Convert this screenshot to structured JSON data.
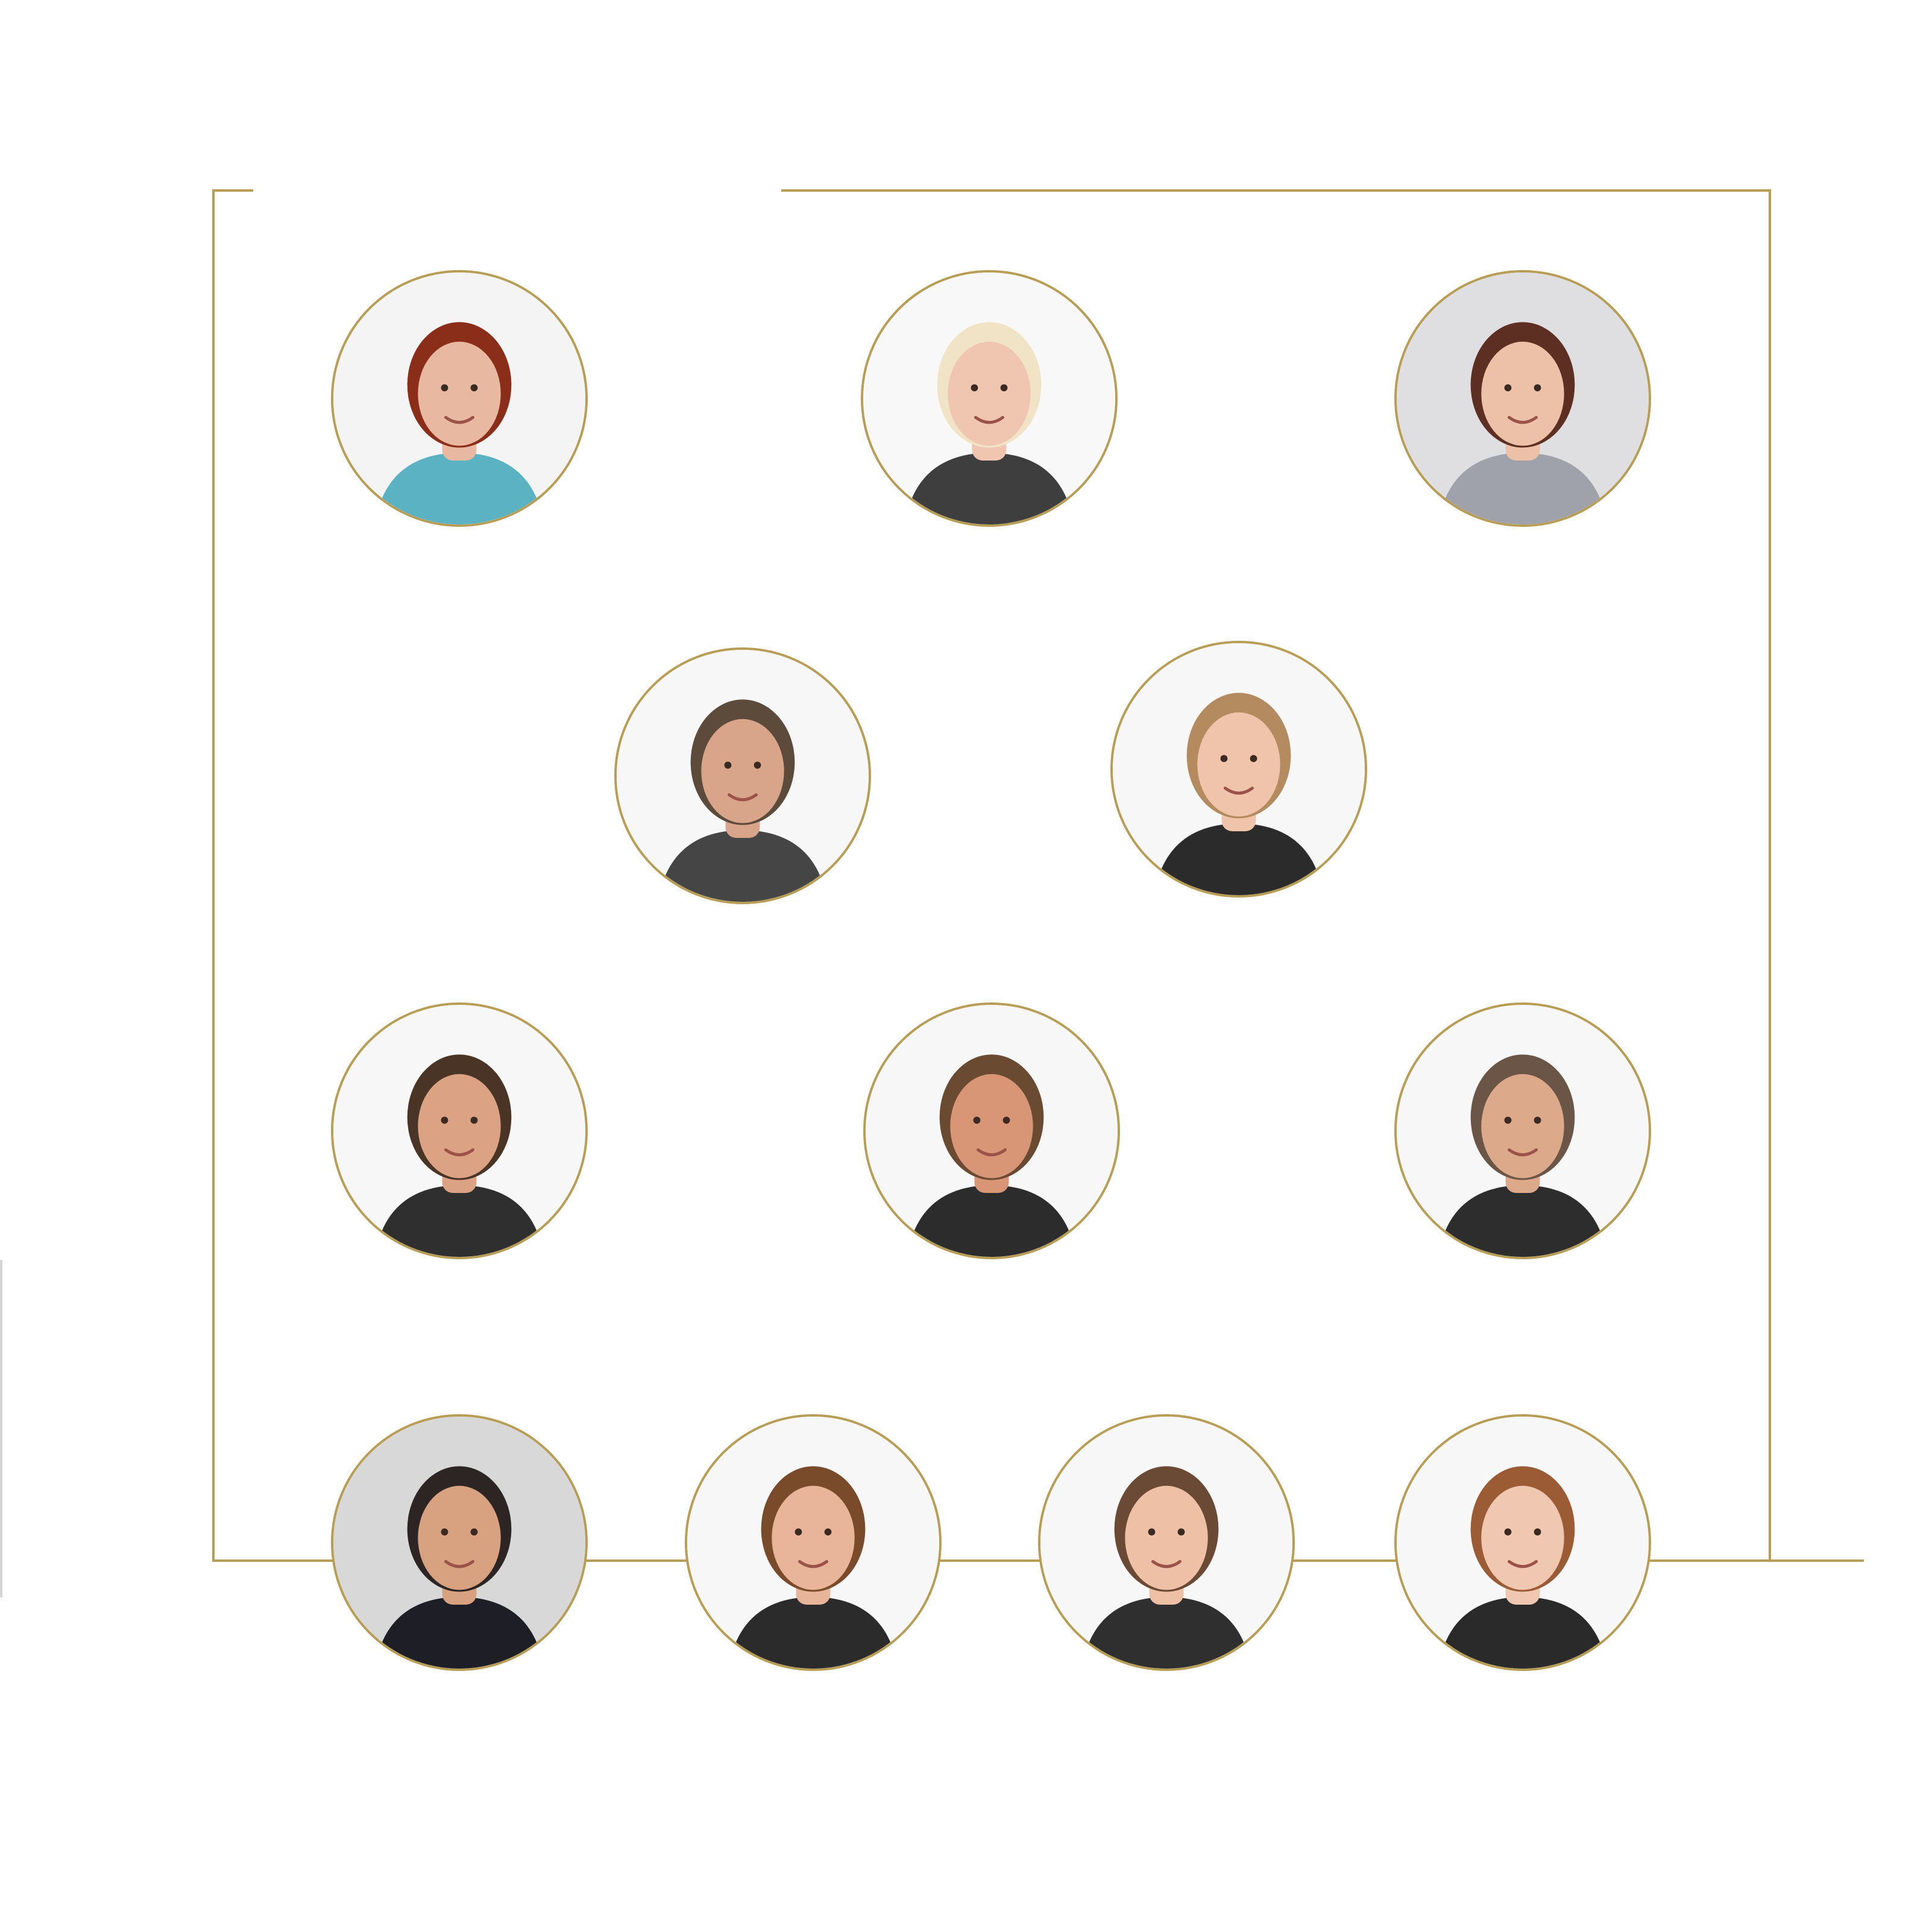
{
  "colors": {
    "accent_gold": "#b89d55",
    "background": "#ffffff"
  },
  "portraits": [
    {
      "name": "woman-red-hair",
      "bg": "#f4f4f4",
      "skin": "#e8b9a0",
      "hair": "#8a2e1a",
      "shirt": "#5bb2c2"
    },
    {
      "name": "woman-blonde-hair",
      "bg": "#f8f8f8",
      "skin": "#f0c6b0",
      "hair": "#f1e4c6",
      "shirt": "#3e3e3e"
    },
    {
      "name": "woman-brown-hair",
      "bg": "#dfdfe2",
      "skin": "#ecc1a8",
      "hair": "#5d2f22",
      "shirt": "#9fa2aa"
    },
    {
      "name": "man-headset-glasses",
      "bg": "#f7f7f7",
      "skin": "#d8a58b",
      "hair": "#5c4a3a",
      "shirt": "#454545"
    },
    {
      "name": "young-man-blond",
      "bg": "#f7f7f7",
      "skin": "#f0c4aa",
      "hair": "#b48a5f",
      "shirt": "#2b2b2b"
    },
    {
      "name": "man-curly-beard",
      "bg": "#f7f7f7",
      "skin": "#dba384",
      "hair": "#4a3426",
      "shirt": "#2f2f2f"
    },
    {
      "name": "man-short-hair",
      "bg": "#f7f7f7",
      "skin": "#d89676",
      "hair": "#6b4a32",
      "shirt": "#2c2c2c"
    },
    {
      "name": "man-bald-smile",
      "bg": "#f7f7f7",
      "skin": "#dca98b",
      "hair": "#6b5546",
      "shirt": "#2d2d2d"
    },
    {
      "name": "man-suit",
      "bg": "#d8d8d8",
      "skin": "#d8a180",
      "hair": "#2c2523",
      "shirt": "#1e1f26"
    },
    {
      "name": "young-man-long-hair",
      "bg": "#f7f7f7",
      "skin": "#e8b59a",
      "hair": "#7a4b2b",
      "shirt": "#2b2b2b"
    },
    {
      "name": "woman-updo",
      "bg": "#f7f7f7",
      "skin": "#eec0a6",
      "hair": "#6a4a35",
      "shirt": "#2f2f2f"
    },
    {
      "name": "woman-ponytail",
      "bg": "#f7f7f7",
      "skin": "#f0c7b0",
      "hair": "#9b5b35",
      "shirt": "#2a2a2a"
    }
  ]
}
